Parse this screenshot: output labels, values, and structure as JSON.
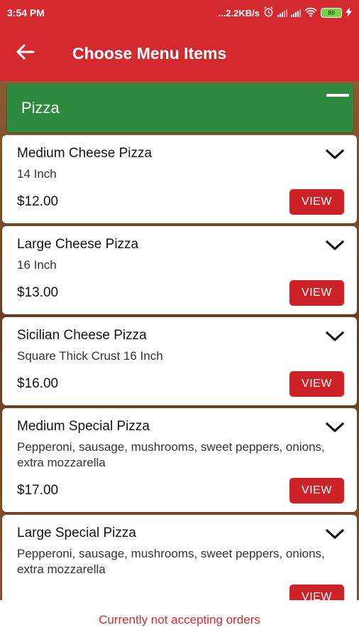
{
  "status_bar": {
    "time": "3:54 PM",
    "network_speed": "...2.2KB/s",
    "battery_level": "80",
    "icons": [
      "alarm-icon",
      "signal-icon",
      "signal-icon",
      "wifi-icon",
      "battery-icon",
      "charging-icon"
    ]
  },
  "app_bar": {
    "title": "Choose Menu Items",
    "back_icon": "arrow-left-icon",
    "color": "#d42a2f"
  },
  "category": {
    "name": "Pizza",
    "color": "#2e8b3e",
    "collapse_icon": "minus-icon"
  },
  "items": [
    {
      "name": "Medium Cheese Pizza",
      "description": "14 Inch",
      "price": "$12.00",
      "button": "VIEW"
    },
    {
      "name": "Large Cheese Pizza",
      "description": "16 Inch",
      "price": "$13.00",
      "button": "VIEW"
    },
    {
      "name": "Sicilian Cheese Pizza",
      "description": "Square Thick Crust 16 Inch",
      "price": "$16.00",
      "button": "VIEW"
    },
    {
      "name": "Medium Special Pizza",
      "description": "Pepperoni, sausage, mushrooms, sweet peppers, onions, extra mozzarella",
      "price": "$17.00",
      "button": "VIEW"
    },
    {
      "name": "Large Special Pizza",
      "description": "Pepperoni, sausage, mushrooms, sweet peppers, onions, extra mozzarella",
      "price": "",
      "button": "VIEW"
    }
  ],
  "footer": {
    "message": "Currently not accepting orders",
    "color": "#d42a2f"
  }
}
